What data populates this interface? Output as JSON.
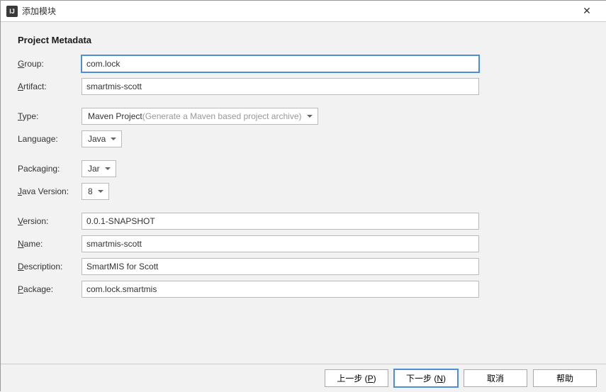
{
  "window": {
    "title": "添加模块",
    "appIconText": "IJ"
  },
  "sectionTitle": "Project Metadata",
  "labels": {
    "group_pre": "G",
    "group_post": "roup:",
    "artifact_pre": "A",
    "artifact_post": "rtifact:",
    "type_pre": "T",
    "type_post": "ype:",
    "language": "Language:",
    "packaging": "Packaging:",
    "javaVersion_pre": "J",
    "javaVersion_post": "ava Version:",
    "version_pre": "V",
    "version_post": "ersion:",
    "name_pre": "N",
    "name_post": "ame:",
    "description_pre": "D",
    "description_post": "escription:",
    "package_pre": "P",
    "package_post": "ackage:"
  },
  "fields": {
    "group": "com.lock",
    "artifact": "smartmis-scott",
    "typeMain": "Maven Project",
    "typeHint": " (Generate a Maven based project archive)",
    "language": "Java",
    "packaging": "Jar",
    "javaVersion": "8",
    "version": "0.0.1-SNAPSHOT",
    "name": "smartmis-scott",
    "description": "SmartMIS for Scott",
    "package": "com.lock.smartmis"
  },
  "buttons": {
    "prev_text": "上一步 (",
    "prev_mn": "P",
    "prev_end": ")",
    "next_text": "下一步 (",
    "next_mn": "N",
    "next_end": ")",
    "cancel": "取消",
    "help": "帮助"
  }
}
